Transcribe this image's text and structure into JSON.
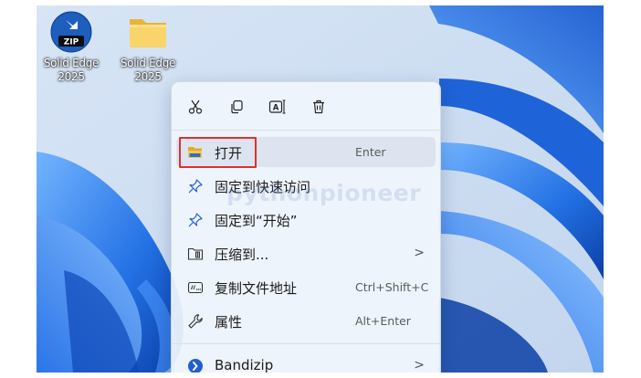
{
  "desktop": {
    "icons": [
      {
        "label": "Solid Edge\n2025",
        "badge": "ZIP",
        "icon": "zip-archive-icon"
      },
      {
        "label": "Solid Edge\n2025",
        "icon": "folder-icon"
      }
    ]
  },
  "context_menu": {
    "toolbar": [
      {
        "name": "cut",
        "icon": "scissors-icon"
      },
      {
        "name": "copy",
        "icon": "copy-icon"
      },
      {
        "name": "rename",
        "icon": "rename-icon"
      },
      {
        "name": "delete",
        "icon": "trash-icon"
      }
    ],
    "items": [
      {
        "label": "打开",
        "accelerator": "Enter",
        "icon": "folder-open-icon"
      },
      {
        "label": "固定到快速访问",
        "accelerator": "",
        "icon": "pin-icon"
      },
      {
        "label": "固定到“开始”",
        "accelerator": "",
        "icon": "pin-icon"
      },
      {
        "label": "压缩到...",
        "accelerator": "",
        "submenu": true,
        "icon": "archive-icon"
      },
      {
        "label": "复制文件地址",
        "accelerator": "Ctrl+Shift+C",
        "icon": "path-icon"
      },
      {
        "label": "属性",
        "accelerator": "Alt+Enter",
        "icon": "wrench-icon"
      },
      {
        "label": "Bandizip",
        "accelerator": "",
        "submenu": true,
        "icon": "bandizip-icon"
      }
    ],
    "submenu_glyph": ">"
  },
  "watermark": "pythonpioneer",
  "colors": {
    "highlight": "#e0302d",
    "wallpaper_blue": "#1c63d9",
    "folder_yellow": "#f7c948"
  }
}
